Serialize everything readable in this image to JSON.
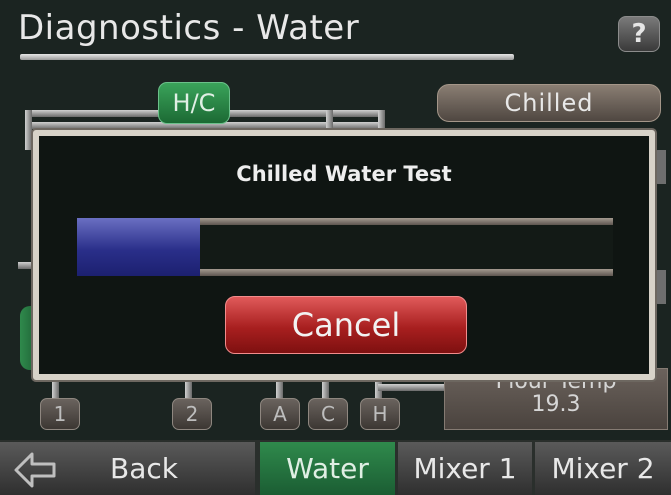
{
  "header": {
    "title": "Diagnostics - Water",
    "help_label": "?"
  },
  "diagram": {
    "hc_button_label": "H/C",
    "chilled_button_label": "Chilled",
    "valves": [
      "1",
      "2",
      "A",
      "C",
      "H"
    ],
    "flour_temp": {
      "label": "Flour Temp",
      "value": "19.3"
    }
  },
  "dialog": {
    "title": "Chilled Water Test",
    "progress_fraction": 0.23,
    "cancel_label": "Cancel"
  },
  "nav": {
    "back_label": "Back",
    "tabs": [
      "Water",
      "Mixer 1",
      "Mixer 2"
    ]
  },
  "colors": {
    "background": "#1b2421",
    "active_tab": "#2f8a4c",
    "cancel": "#a81f1f",
    "progress": "#2a2f8a"
  }
}
